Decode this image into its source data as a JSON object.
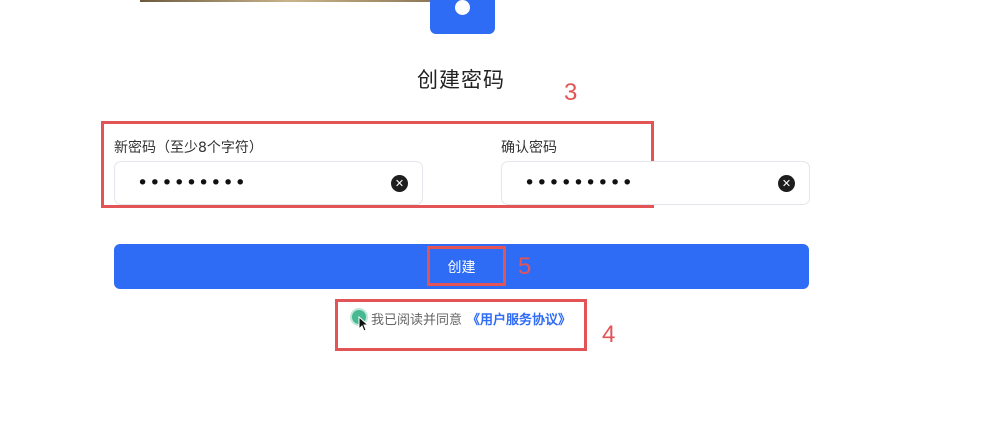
{
  "header": {
    "title": "创建密码"
  },
  "form": {
    "new_password": {
      "label": "新密码（至少8个字符）",
      "value": "•••••••••"
    },
    "confirm_password": {
      "label": "确认密码",
      "value": "•••••••••"
    },
    "clear_glyph": "✕"
  },
  "actions": {
    "create_label": "创建"
  },
  "agreement": {
    "text": "我已阅读并同意",
    "link": "《用户服务协议》",
    "checked": true
  },
  "annotations": {
    "fields_marker": "3",
    "agreement_marker": "4",
    "create_marker": "5",
    "color": "#e35456"
  },
  "colors": {
    "accent": "#2f6cf6",
    "radio_checked": "#46b892"
  }
}
